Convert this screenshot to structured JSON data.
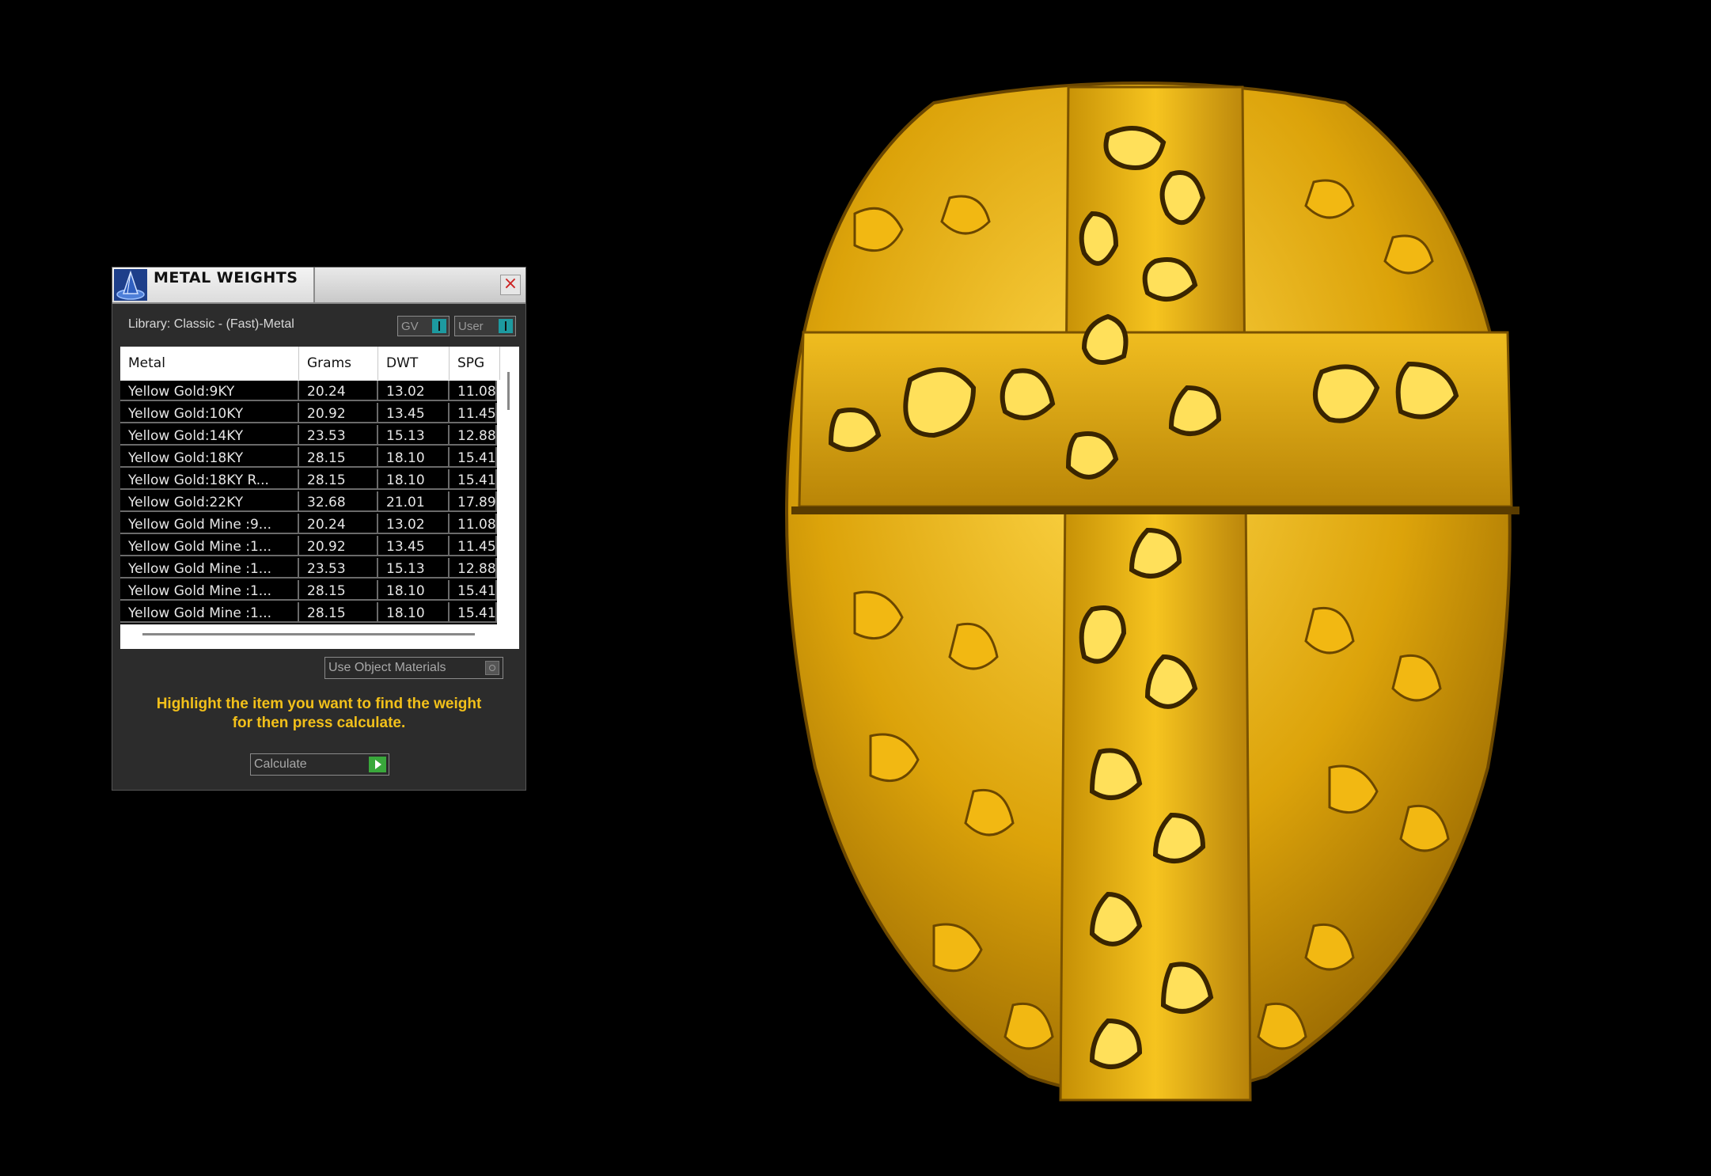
{
  "panel": {
    "title": "METAL WEIGHTS",
    "library": "Library: Classic - (Fast)-Metal",
    "toggles": [
      {
        "label": "GV"
      },
      {
        "label": "User"
      }
    ],
    "columns": [
      "Metal",
      "Grams",
      "DWT",
      "SPG"
    ],
    "rows": [
      [
        "Yellow Gold:9KY",
        "20.24",
        "13.02",
        "11.08"
      ],
      [
        "Yellow Gold:10KY",
        "20.92",
        "13.45",
        "11.45"
      ],
      [
        "Yellow Gold:14KY",
        "23.53",
        "15.13",
        "12.88"
      ],
      [
        "Yellow Gold:18KY",
        "28.15",
        "18.10",
        "15.41"
      ],
      [
        "Yellow Gold:18KY R...",
        "28.15",
        "18.10",
        "15.41"
      ],
      [
        "Yellow Gold:22KY",
        "32.68",
        "21.01",
        "17.89"
      ],
      [
        "Yellow Gold Mine :9...",
        "20.24",
        "13.02",
        "11.08"
      ],
      [
        "Yellow Gold Mine :1...",
        "20.92",
        "13.45",
        "11.45"
      ],
      [
        "Yellow Gold Mine :1...",
        "23.53",
        "15.13",
        "12.88"
      ],
      [
        "Yellow Gold Mine :1...",
        "28.15",
        "18.10",
        "15.41"
      ],
      [
        "Yellow Gold Mine :1...",
        "28.15",
        "18.10",
        "15.41"
      ]
    ],
    "use_object_materials": "Use Object Materials",
    "hint_line1": "Highlight the item you want to find the weight",
    "hint_line2": "for then press calculate.",
    "calculate": "Calculate"
  },
  "colors": {
    "hint": "#f2c01a",
    "toggle": "#1d9aa0",
    "play": "#39a83b",
    "gold": "#e0b10c"
  }
}
